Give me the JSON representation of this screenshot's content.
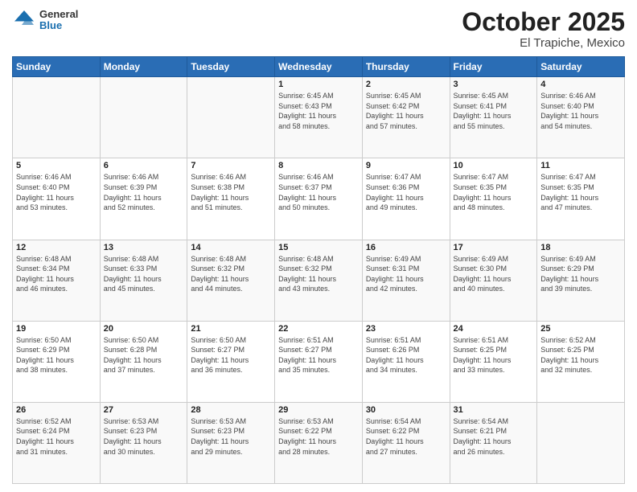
{
  "header": {
    "logo_general": "General",
    "logo_blue": "Blue",
    "title_month": "October 2025",
    "title_location": "El Trapiche, Mexico"
  },
  "days_of_week": [
    "Sunday",
    "Monday",
    "Tuesday",
    "Wednesday",
    "Thursday",
    "Friday",
    "Saturday"
  ],
  "weeks": [
    [
      {
        "date": "",
        "info": ""
      },
      {
        "date": "",
        "info": ""
      },
      {
        "date": "",
        "info": ""
      },
      {
        "date": "1",
        "info": "Sunrise: 6:45 AM\nSunset: 6:43 PM\nDaylight: 11 hours\nand 58 minutes."
      },
      {
        "date": "2",
        "info": "Sunrise: 6:45 AM\nSunset: 6:42 PM\nDaylight: 11 hours\nand 57 minutes."
      },
      {
        "date": "3",
        "info": "Sunrise: 6:45 AM\nSunset: 6:41 PM\nDaylight: 11 hours\nand 55 minutes."
      },
      {
        "date": "4",
        "info": "Sunrise: 6:46 AM\nSunset: 6:40 PM\nDaylight: 11 hours\nand 54 minutes."
      }
    ],
    [
      {
        "date": "5",
        "info": "Sunrise: 6:46 AM\nSunset: 6:40 PM\nDaylight: 11 hours\nand 53 minutes."
      },
      {
        "date": "6",
        "info": "Sunrise: 6:46 AM\nSunset: 6:39 PM\nDaylight: 11 hours\nand 52 minutes."
      },
      {
        "date": "7",
        "info": "Sunrise: 6:46 AM\nSunset: 6:38 PM\nDaylight: 11 hours\nand 51 minutes."
      },
      {
        "date": "8",
        "info": "Sunrise: 6:46 AM\nSunset: 6:37 PM\nDaylight: 11 hours\nand 50 minutes."
      },
      {
        "date": "9",
        "info": "Sunrise: 6:47 AM\nSunset: 6:36 PM\nDaylight: 11 hours\nand 49 minutes."
      },
      {
        "date": "10",
        "info": "Sunrise: 6:47 AM\nSunset: 6:35 PM\nDaylight: 11 hours\nand 48 minutes."
      },
      {
        "date": "11",
        "info": "Sunrise: 6:47 AM\nSunset: 6:35 PM\nDaylight: 11 hours\nand 47 minutes."
      }
    ],
    [
      {
        "date": "12",
        "info": "Sunrise: 6:48 AM\nSunset: 6:34 PM\nDaylight: 11 hours\nand 46 minutes."
      },
      {
        "date": "13",
        "info": "Sunrise: 6:48 AM\nSunset: 6:33 PM\nDaylight: 11 hours\nand 45 minutes."
      },
      {
        "date": "14",
        "info": "Sunrise: 6:48 AM\nSunset: 6:32 PM\nDaylight: 11 hours\nand 44 minutes."
      },
      {
        "date": "15",
        "info": "Sunrise: 6:48 AM\nSunset: 6:32 PM\nDaylight: 11 hours\nand 43 minutes."
      },
      {
        "date": "16",
        "info": "Sunrise: 6:49 AM\nSunset: 6:31 PM\nDaylight: 11 hours\nand 42 minutes."
      },
      {
        "date": "17",
        "info": "Sunrise: 6:49 AM\nSunset: 6:30 PM\nDaylight: 11 hours\nand 40 minutes."
      },
      {
        "date": "18",
        "info": "Sunrise: 6:49 AM\nSunset: 6:29 PM\nDaylight: 11 hours\nand 39 minutes."
      }
    ],
    [
      {
        "date": "19",
        "info": "Sunrise: 6:50 AM\nSunset: 6:29 PM\nDaylight: 11 hours\nand 38 minutes."
      },
      {
        "date": "20",
        "info": "Sunrise: 6:50 AM\nSunset: 6:28 PM\nDaylight: 11 hours\nand 37 minutes."
      },
      {
        "date": "21",
        "info": "Sunrise: 6:50 AM\nSunset: 6:27 PM\nDaylight: 11 hours\nand 36 minutes."
      },
      {
        "date": "22",
        "info": "Sunrise: 6:51 AM\nSunset: 6:27 PM\nDaylight: 11 hours\nand 35 minutes."
      },
      {
        "date": "23",
        "info": "Sunrise: 6:51 AM\nSunset: 6:26 PM\nDaylight: 11 hours\nand 34 minutes."
      },
      {
        "date": "24",
        "info": "Sunrise: 6:51 AM\nSunset: 6:25 PM\nDaylight: 11 hours\nand 33 minutes."
      },
      {
        "date": "25",
        "info": "Sunrise: 6:52 AM\nSunset: 6:25 PM\nDaylight: 11 hours\nand 32 minutes."
      }
    ],
    [
      {
        "date": "26",
        "info": "Sunrise: 6:52 AM\nSunset: 6:24 PM\nDaylight: 11 hours\nand 31 minutes."
      },
      {
        "date": "27",
        "info": "Sunrise: 6:53 AM\nSunset: 6:23 PM\nDaylight: 11 hours\nand 30 minutes."
      },
      {
        "date": "28",
        "info": "Sunrise: 6:53 AM\nSunset: 6:23 PM\nDaylight: 11 hours\nand 29 minutes."
      },
      {
        "date": "29",
        "info": "Sunrise: 6:53 AM\nSunset: 6:22 PM\nDaylight: 11 hours\nand 28 minutes."
      },
      {
        "date": "30",
        "info": "Sunrise: 6:54 AM\nSunset: 6:22 PM\nDaylight: 11 hours\nand 27 minutes."
      },
      {
        "date": "31",
        "info": "Sunrise: 6:54 AM\nSunset: 6:21 PM\nDaylight: 11 hours\nand 26 minutes."
      },
      {
        "date": "",
        "info": ""
      }
    ]
  ]
}
